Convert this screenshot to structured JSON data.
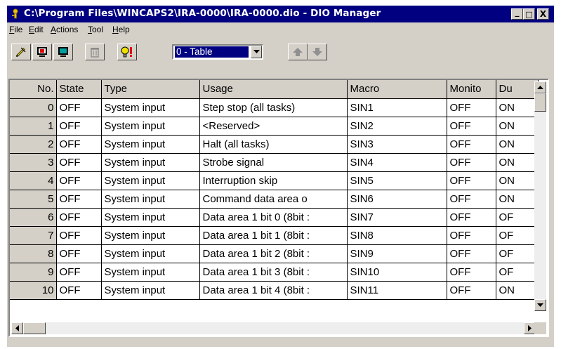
{
  "window": {
    "title": "C:\\Program Files\\WINCAPS2\\IRA-0000\\IRA-0000.dio - DIO Manager",
    "controls": {
      "minimize": "_",
      "maximize": "□",
      "close": "X"
    }
  },
  "menu": [
    {
      "label": "File",
      "mnemonic": "F",
      "rest": "ile"
    },
    {
      "label": "Edit",
      "mnemonic": "E",
      "rest": "dit"
    },
    {
      "label": "Actions",
      "mnemonic": "A",
      "rest": "ctions"
    },
    {
      "label": "Tool",
      "mnemonic": "T",
      "rest": "ool"
    },
    {
      "label": "Help",
      "mnemonic": "H",
      "rest": "elp"
    }
  ],
  "toolbar": {
    "buttons": [
      "edit-pencil-icon",
      "monitor-red-icon",
      "monitor-teal-icon",
      "trash-icon",
      "bulb-warning-icon",
      "move-up-icon",
      "move-down-icon"
    ],
    "combo_value": "0 - Table"
  },
  "grid": {
    "columns": [
      "No.",
      "State",
      "Type",
      "Usage",
      "Macro",
      "Monito",
      "Du"
    ],
    "rows": [
      [
        "0",
        "OFF",
        "System input",
        "Step stop (all tasks)",
        "SIN1",
        "OFF",
        "ON"
      ],
      [
        "1",
        "OFF",
        "System input",
        "<Reserved>",
        "SIN2",
        "OFF",
        "ON"
      ],
      [
        "2",
        "OFF",
        "System input",
        "Halt (all tasks)",
        "SIN3",
        "OFF",
        "ON"
      ],
      [
        "3",
        "OFF",
        "System input",
        "Strobe signal",
        "SIN4",
        "OFF",
        "ON"
      ],
      [
        "4",
        "OFF",
        "System input",
        "Interruption skip",
        "SIN5",
        "OFF",
        "ON"
      ],
      [
        "5",
        "OFF",
        "System input",
        "Command data area o",
        "SIN6",
        "OFF",
        "ON"
      ],
      [
        "6",
        "OFF",
        "System input",
        "Data area 1 bit 0 (8bit :",
        "SIN7",
        "OFF",
        "OF"
      ],
      [
        "7",
        "OFF",
        "System input",
        "Data area 1 bit 1 (8bit :",
        "SIN8",
        "OFF",
        "OF"
      ],
      [
        "8",
        "OFF",
        "System input",
        "Data area 1 bit 2 (8bit :",
        "SIN9",
        "OFF",
        "OF"
      ],
      [
        "9",
        "OFF",
        "System input",
        "Data area 1 bit 3 (8bit :",
        "SIN10",
        "OFF",
        "OF"
      ],
      [
        "10",
        "OFF",
        "System input",
        "Data area 1 bit 4 (8bit :",
        "SIN11",
        "OFF",
        "ON"
      ]
    ]
  },
  "colors": {
    "titlebar": "#000080",
    "face": "#d4d0c8",
    "selection": "#000080"
  }
}
